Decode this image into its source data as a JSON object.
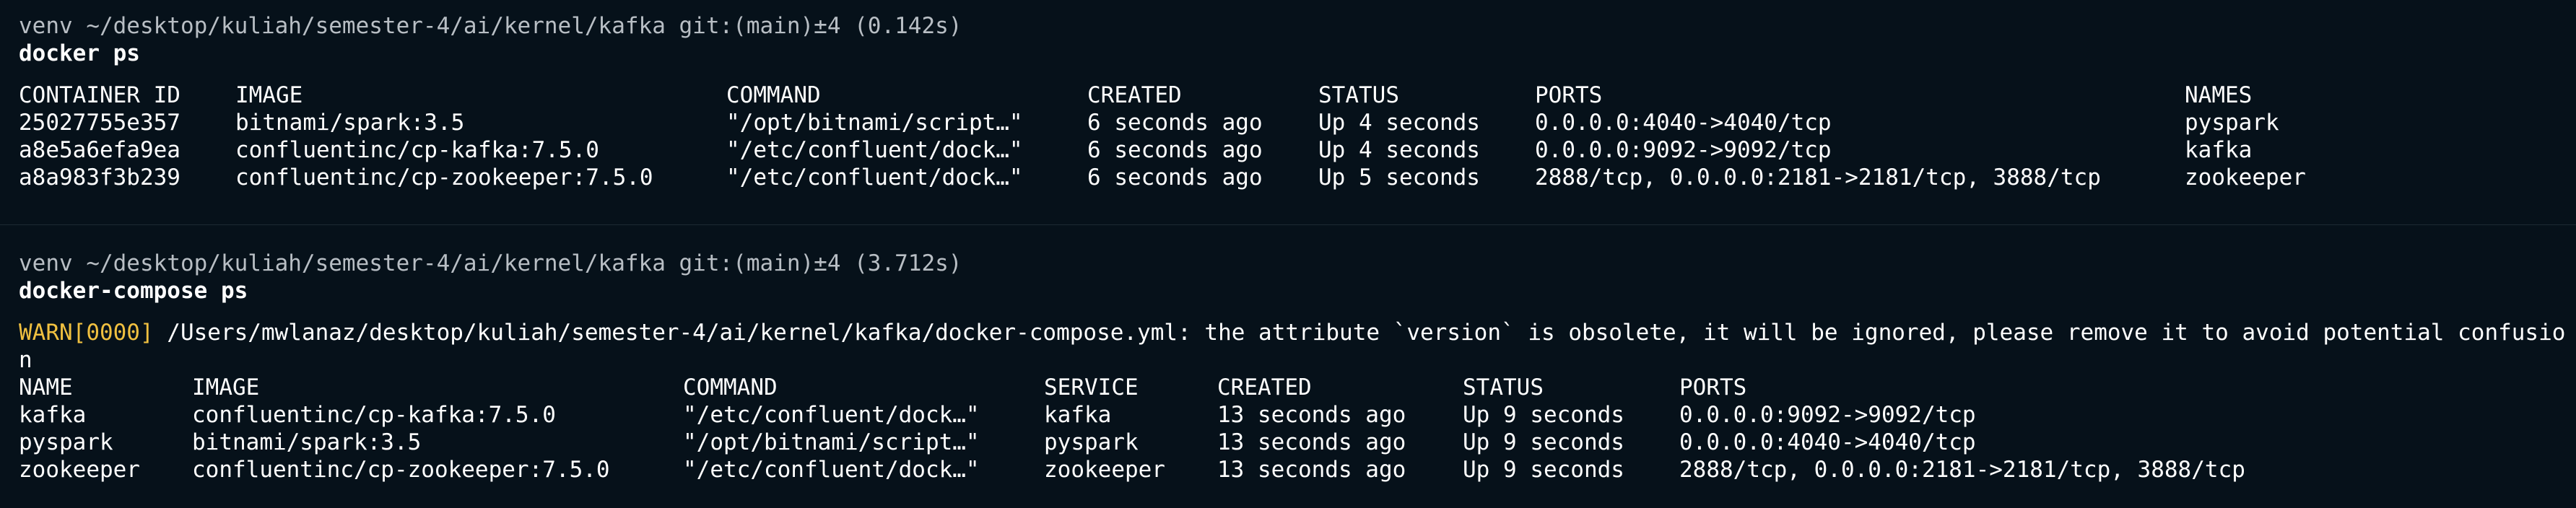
{
  "session1": {
    "prompt": "venv ~/desktop/kuliah/semester-4/ai/kernel/kafka git:(main)±4 (0.142s)",
    "command": "docker ps",
    "headers": [
      "CONTAINER ID",
      "IMAGE",
      "COMMAND",
      "CREATED",
      "STATUS",
      "PORTS",
      "NAMES"
    ],
    "rows": [
      [
        "25027755e357",
        "bitnami/spark:3.5",
        "\"/opt/bitnami/script…\"",
        "6 seconds ago",
        "Up 4 seconds",
        "0.0.0.0:4040->4040/tcp",
        "pyspark"
      ],
      [
        "a8e5a6efa9ea",
        "confluentinc/cp-kafka:7.5.0",
        "\"/etc/confluent/dock…\"",
        "6 seconds ago",
        "Up 4 seconds",
        "0.0.0.0:9092->9092/tcp",
        "kafka"
      ],
      [
        "a8a983f3b239",
        "confluentinc/cp-zookeeper:7.5.0",
        "\"/etc/confluent/dock…\"",
        "6 seconds ago",
        "Up 5 seconds",
        "2888/tcp, 0.0.0.0:2181->2181/tcp, 3888/tcp",
        "zookeeper"
      ]
    ]
  },
  "session2": {
    "prompt": "venv ~/desktop/kuliah/semester-4/ai/kernel/kafka git:(main)±4 (3.712s)",
    "command": "docker-compose ps",
    "warn_tag": "WARN[0000]",
    "warn_message": " /Users/mwlanaz/desktop/kuliah/semester-4/ai/kernel/kafka/docker-compose.yml: the attribute `version` is obsolete, it will be ignored, please remove it to avoid potential confusion",
    "headers": [
      "NAME",
      "IMAGE",
      "COMMAND",
      "SERVICE",
      "CREATED",
      "STATUS",
      "PORTS"
    ],
    "rows": [
      [
        "kafka",
        "confluentinc/cp-kafka:7.5.0",
        "\"/etc/confluent/dock…\"",
        "kafka",
        "13 seconds ago",
        "Up 9 seconds",
        "0.0.0.0:9092->9092/tcp"
      ],
      [
        "pyspark",
        "bitnami/spark:3.5",
        "\"/opt/bitnami/script…\"",
        "pyspark",
        "13 seconds ago",
        "Up 9 seconds",
        "0.0.0.0:4040->4040/tcp"
      ],
      [
        "zookeeper",
        "confluentinc/cp-zookeeper:7.5.0",
        "\"/etc/confluent/dock…\"",
        "zookeeper",
        "13 seconds ago",
        "Up 9 seconds",
        "2888/tcp, 0.0.0.0:2181->2181/tcp, 3888/tcp"
      ]
    ]
  },
  "colors": {
    "background": "#06111a",
    "prompt": "#b8bec4",
    "text": "#ffffff",
    "warn": "#f0c040",
    "divider": "#1d2a33"
  }
}
